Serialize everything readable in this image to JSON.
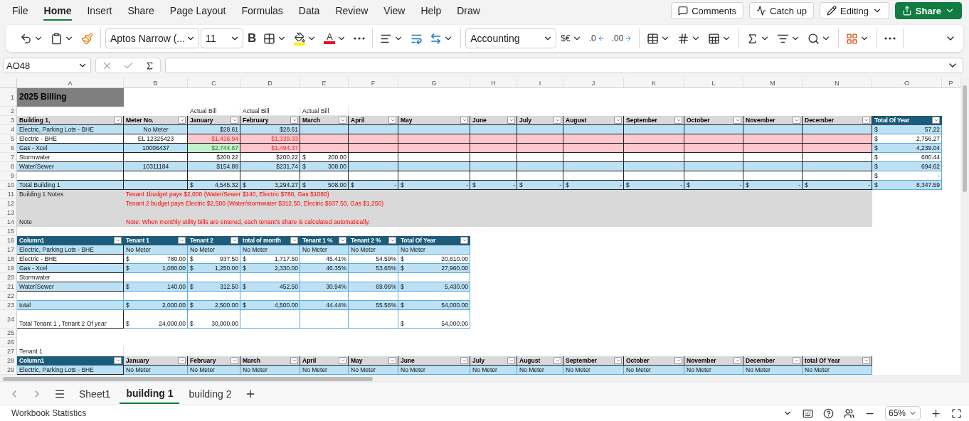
{
  "menu_tabs": [
    {
      "label": "File",
      "selected": false
    },
    {
      "label": "Home",
      "selected": true
    },
    {
      "label": "Insert",
      "selected": false
    },
    {
      "label": "Share",
      "selected": false
    },
    {
      "label": "Page Layout",
      "selected": false
    },
    {
      "label": "Formulas",
      "selected": false
    },
    {
      "label": "Data",
      "selected": false
    },
    {
      "label": "Review",
      "selected": false
    },
    {
      "label": "View",
      "selected": false
    },
    {
      "label": "Help",
      "selected": false
    },
    {
      "label": "Draw",
      "selected": false
    }
  ],
  "header_buttons": [
    {
      "kind": "comments",
      "label": "Comments"
    },
    {
      "kind": "catchup",
      "label": "Catch up"
    },
    {
      "kind": "editing",
      "label": "Editing",
      "caret": true
    },
    {
      "kind": "share",
      "label": "Share",
      "caret": true
    }
  ],
  "ribbon": {
    "groups": [
      [
        {
          "kind": "undo",
          "caret": true
        },
        {
          "kind": "paste",
          "caret": true
        },
        {
          "kind": "painter"
        }
      ],
      [
        {
          "kind": "font",
          "value": "Aptos Narrow (..."
        },
        {
          "kind": "size",
          "value": "11"
        },
        {
          "kind": "bold",
          "label": "B"
        },
        {
          "kind": "borders",
          "caret": true
        },
        {
          "kind": "fill",
          "caret": true
        },
        {
          "kind": "fontcolor",
          "label": "A",
          "caret": true
        },
        {
          "kind": "more"
        }
      ],
      [
        {
          "kind": "align",
          "caret": true
        },
        {
          "kind": "wrap"
        },
        {
          "kind": "merge",
          "caret": true
        }
      ],
      [
        {
          "kind": "format",
          "value": "Accounting"
        },
        {
          "kind": "currency",
          "label": "$€",
          "caret": true
        },
        {
          "kind": "decdec",
          "label": ".0"
        },
        {
          "kind": "incdec",
          "label": ".00"
        }
      ],
      [
        {
          "kind": "condfmt",
          "caret": true
        },
        {
          "kind": "cellstyles",
          "caret": true
        },
        {
          "kind": "formattable",
          "caret": true
        }
      ],
      [
        {
          "kind": "sum",
          "caret": true
        },
        {
          "kind": "sortfilter",
          "caret": true
        },
        {
          "kind": "find",
          "caret": true
        }
      ],
      [
        {
          "kind": "addins",
          "caret": true
        }
      ],
      [
        {
          "kind": "more"
        }
      ]
    ]
  },
  "formula_bar": {
    "name_box": "AO48"
  },
  "sheet": {
    "column_letters": [
      "A",
      "B",
      "C",
      "D",
      "E",
      "F",
      "G",
      "H",
      "I",
      "J",
      "K",
      "L",
      "M",
      "N",
      "O",
      "P"
    ],
    "rows": [
      {
        "number": "1",
        "tall": true,
        "cells": [
          {
            "text": "2025 Billing",
            "kind": "title"
          }
        ]
      },
      {
        "number": "2",
        "cells": [
          {},
          {},
          {
            "text": "Actual Bill"
          },
          {
            "text": "Actual Bill"
          },
          {
            "text": "Actual Bill"
          }
        ]
      },
      {
        "number": "3",
        "cells": [
          {
            "text": "Building 1,",
            "kind": "head",
            "filter": true
          },
          {
            "text": "Meter No.",
            "kind": "head",
            "filter": true
          },
          {
            "text": "January",
            "kind": "head",
            "filter": true
          },
          {
            "text": "February",
            "kind": "head",
            "filter": true
          },
          {
            "text": "March",
            "kind": "head",
            "filter": true
          },
          {
            "text": "April",
            "kind": "head",
            "filter": true
          },
          {
            "text": "May",
            "kind": "head",
            "filter": true
          },
          {
            "text": "June",
            "kind": "head",
            "filter": true
          },
          {
            "text": "July",
            "kind": "head",
            "filter": true
          },
          {
            "text": "August",
            "kind": "head",
            "filter": true
          },
          {
            "text": "September",
            "kind": "head",
            "filter": true
          },
          {
            "text": "October",
            "kind": "head",
            "filter": true
          },
          {
            "text": "November",
            "kind": "head",
            "filter": true
          },
          {
            "text": "December",
            "kind": "head",
            "filter": true
          },
          {
            "text": "Total Of Year",
            "kind": "navy",
            "filter": true
          }
        ]
      },
      {
        "number": "4",
        "cells": [
          {
            "text": "Electric, Parking Lots - BHE",
            "kind": "blue"
          },
          {
            "text": "No Meter",
            "kind": "blue",
            "centered": true
          },
          {
            "text": "$28.61",
            "kind": "blue",
            "numeric": true
          },
          {
            "text": "$28.61",
            "kind": "blue",
            "numeric": true
          },
          {
            "kind": "blue"
          },
          {
            "kind": "blue"
          },
          {
            "kind": "blue"
          },
          {
            "kind": "blue"
          },
          {
            "kind": "blue"
          },
          {
            "kind": "blue"
          },
          {
            "kind": "blue"
          },
          {
            "kind": "blue"
          },
          {
            "kind": "blue"
          },
          {
            "kind": "blue"
          },
          {
            "currency": "$",
            "text": "57.22",
            "kind": "band"
          }
        ]
      },
      {
        "number": "5",
        "cells": [
          {
            "text": "Electric - BHE",
            "kind": "white"
          },
          {
            "text": "EL 12325423",
            "kind": "white",
            "centered": true
          },
          {
            "text": "$1,416.94",
            "kind": "pink",
            "numeric": true
          },
          {
            "text": "$1,339.33",
            "kind": "pink",
            "numeric": true
          },
          {
            "kind": "pink"
          },
          {
            "kind": "pink"
          },
          {
            "kind": "pink"
          },
          {
            "kind": "pink"
          },
          {
            "kind": "pink"
          },
          {
            "kind": "pink"
          },
          {
            "kind": "pink"
          },
          {
            "kind": "pink"
          },
          {
            "kind": "pink"
          },
          {
            "kind": "pink"
          },
          {
            "currency": "$",
            "text": "2,756.27",
            "kind": "lined"
          }
        ]
      },
      {
        "number": "6",
        "cells": [
          {
            "text": "Gas - Xcel",
            "kind": "blue"
          },
          {
            "text": "10006437",
            "kind": "blue",
            "centered": true
          },
          {
            "text": "$2,744.67",
            "kind": "green",
            "numeric": true
          },
          {
            "text": "$1,494.37",
            "kind": "pink",
            "numeric": true
          },
          {
            "kind": "pink"
          },
          {
            "kind": "pink"
          },
          {
            "kind": "pink"
          },
          {
            "kind": "pink"
          },
          {
            "kind": "pink"
          },
          {
            "kind": "pink"
          },
          {
            "kind": "pink"
          },
          {
            "kind": "pink"
          },
          {
            "kind": "pink"
          },
          {
            "kind": "pink"
          },
          {
            "currency": "$",
            "text": "4,239.04",
            "kind": "band"
          }
        ]
      },
      {
        "number": "7",
        "cells": [
          {
            "text": "Stormwater",
            "kind": "white"
          },
          {
            "kind": "white"
          },
          {
            "text": "$200.22",
            "kind": "white",
            "numeric": true
          },
          {
            "text": "$200.22",
            "kind": "white",
            "numeric": true
          },
          {
            "currency": "$",
            "text": "200.00",
            "kind": "white"
          },
          {
            "kind": "white"
          },
          {
            "kind": "white"
          },
          {
            "kind": "white"
          },
          {
            "kind": "white"
          },
          {
            "kind": "white"
          },
          {
            "kind": "white"
          },
          {
            "kind": "white"
          },
          {
            "kind": "white"
          },
          {
            "kind": "white"
          },
          {
            "currency": "$",
            "text": "600.44",
            "kind": "lined"
          }
        ]
      },
      {
        "number": "8",
        "cells": [
          {
            "text": "Water/Sewer",
            "kind": "blue"
          },
          {
            "text": "10311184",
            "kind": "blue",
            "centered": true
          },
          {
            "text": "$154.88",
            "kind": "blue",
            "numeric": true
          },
          {
            "text": "$231.74",
            "kind": "blue",
            "numeric": true
          },
          {
            "currency": "$",
            "text": "308.00",
            "kind": "blue"
          },
          {
            "kind": "blue"
          },
          {
            "kind": "blue"
          },
          {
            "kind": "blue"
          },
          {
            "kind": "blue"
          },
          {
            "kind": "blue"
          },
          {
            "kind": "blue"
          },
          {
            "kind": "blue"
          },
          {
            "kind": "blue"
          },
          {
            "kind": "blue"
          },
          {
            "currency": "$",
            "text": "694.62",
            "kind": "band"
          }
        ]
      },
      {
        "number": "9",
        "cells": [
          {
            "kind": "white"
          },
          {
            "kind": "white"
          },
          {
            "kind": "white"
          },
          {
            "kind": "white"
          },
          {
            "kind": "white"
          },
          {
            "kind": "white"
          },
          {
            "kind": "white"
          },
          {
            "kind": "white"
          },
          {
            "kind": "white"
          },
          {
            "kind": "white"
          },
          {
            "kind": "white"
          },
          {
            "kind": "white"
          },
          {
            "kind": "white"
          },
          {
            "kind": "white"
          },
          {
            "currency": "$",
            "text": "-",
            "kind": "lined"
          }
        ]
      },
      {
        "number": "10",
        "cells": [
          {
            "text": "Total Building 1",
            "kind": "blue"
          },
          {
            "kind": "blue"
          },
          {
            "currency": "$",
            "text": "4,545.32",
            "kind": "blue"
          },
          {
            "currency": "$",
            "text": "3,294.27",
            "kind": "blue"
          },
          {
            "currency": "$",
            "text": "508.00",
            "kind": "blue"
          },
          {
            "currency": "$",
            "text": "-",
            "kind": "blue"
          },
          {
            "currency": "$",
            "text": "-",
            "kind": "blue"
          },
          {
            "currency": "$",
            "text": "-",
            "kind": "blue"
          },
          {
            "currency": "$",
            "text": "-",
            "kind": "blue"
          },
          {
            "currency": "$",
            "text": "-",
            "kind": "blue"
          },
          {
            "currency": "$",
            "text": "-",
            "kind": "blue"
          },
          {
            "currency": "$",
            "text": "-",
            "kind": "blue"
          },
          {
            "currency": "$",
            "text": "-",
            "kind": "blue"
          },
          {
            "currency": "$",
            "text": "-",
            "kind": "blue"
          },
          {
            "currency": "$",
            "text": "8,347.59",
            "kind": "band"
          }
        ]
      },
      {
        "number": "11",
        "cells": [
          {
            "text": "Building 1 Notes",
            "kind": "gray"
          },
          {
            "text": "Tenant 1budget pays $2,000 (Water/Sewer $140, Electric $780, Gas $1080)",
            "kind": "note"
          }
        ]
      },
      {
        "number": "12",
        "cells": [
          {
            "kind": "gray"
          },
          {
            "text": "Tenant 2 budget pays Electric $2,500 (Water/stormwater $312.50, Electric $937.50, Gas $1,250)",
            "kind": "note"
          }
        ]
      },
      {
        "number": "13",
        "cells": [
          {
            "kind": "gray"
          },
          {
            "kind": "gray"
          }
        ]
      },
      {
        "number": "14",
        "cells": [
          {
            "text": "Note",
            "kind": "gray"
          },
          {
            "text": "Note: When monthly utility bills are entered, each tenant's share is calculated automatically.",
            "kind": "note"
          }
        ]
      },
      {
        "number": "15",
        "cells": []
      },
      {
        "number": "16",
        "cells": [
          {
            "text": "Column1",
            "kind": "navy",
            "filter": true
          },
          {
            "text": "Tenant 1",
            "kind": "navy",
            "filter": true
          },
          {
            "text": "Tenant 2",
            "kind": "navy",
            "filter": true
          },
          {
            "text": "total of month",
            "kind": "navy",
            "filter": true
          },
          {
            "text": "Tenant 1 %",
            "kind": "navy",
            "filter": true
          },
          {
            "text": "Tenant 2 %",
            "kind": "navy",
            "filter": true
          },
          {
            "text": "Total Of Year",
            "kind": "navy",
            "filter": true
          }
        ]
      },
      {
        "number": "17",
        "cells": [
          {
            "text": "Electric, Parking Lots - BHE",
            "kind": "blue"
          },
          {
            "text": "No Meter",
            "kind": "band"
          },
          {
            "text": "No Meter",
            "kind": "band"
          },
          {
            "text": "No Meter",
            "kind": "band"
          },
          {
            "text": "No Meter",
            "kind": "band"
          },
          {
            "text": "No Meter",
            "kind": "band"
          },
          {
            "text": "No Meter",
            "kind": "band"
          }
        ]
      },
      {
        "number": "18",
        "cells": [
          {
            "text": "Electric - BHE",
            "kind": "white"
          },
          {
            "currency": "$",
            "text": "780.00",
            "kind": "lined"
          },
          {
            "currency": "$",
            "text": "937.50",
            "kind": "lined"
          },
          {
            "currency": "$",
            "text": "1,717.50",
            "kind": "lined"
          },
          {
            "text": "45.41%",
            "kind": "lined",
            "numeric": true
          },
          {
            "text": "54.59%",
            "kind": "lined",
            "numeric": true
          },
          {
            "currency": "$",
            "text": "20,610.00",
            "kind": "lined"
          }
        ]
      },
      {
        "number": "19",
        "cells": [
          {
            "text": "Gas - Xcel",
            "kind": "blue"
          },
          {
            "currency": "$",
            "text": "1,080.00",
            "kind": "band"
          },
          {
            "currency": "$",
            "text": "1,250.00",
            "kind": "band"
          },
          {
            "currency": "$",
            "text": "2,330.00",
            "kind": "band"
          },
          {
            "text": "46.35%",
            "kind": "band",
            "numeric": true
          },
          {
            "text": "53.65%",
            "kind": "band",
            "numeric": true
          },
          {
            "currency": "$",
            "text": "27,960.00",
            "kind": "band"
          }
        ]
      },
      {
        "number": "20",
        "cells": [
          {
            "text": "Stormwater",
            "kind": "white"
          },
          {
            "kind": "lined"
          },
          {
            "kind": "lined"
          },
          {
            "kind": "lined"
          },
          {
            "kind": "lined"
          },
          {
            "kind": "lined"
          },
          {
            "kind": "lined"
          }
        ]
      },
      {
        "number": "21",
        "cells": [
          {
            "text": "Water/Sewer",
            "kind": "blue"
          },
          {
            "currency": "$",
            "text": "140.00",
            "kind": "band"
          },
          {
            "currency": "$",
            "text": "312.50",
            "kind": "band"
          },
          {
            "currency": "$",
            "text": "452.50",
            "kind": "band"
          },
          {
            "text": "30.94%",
            "kind": "band",
            "numeric": true
          },
          {
            "text": "69.06%",
            "kind": "band",
            "numeric": true
          },
          {
            "currency": "$",
            "text": "5,430.00",
            "kind": "band"
          }
        ]
      },
      {
        "number": "22",
        "cells": [
          {
            "kind": "lined"
          },
          {
            "kind": "lined"
          },
          {
            "kind": "lined"
          },
          {
            "kind": "lined"
          },
          {
            "kind": "lined"
          },
          {
            "kind": "lined"
          },
          {
            "kind": "lined"
          }
        ]
      },
      {
        "number": "23",
        "cells": [
          {
            "text": "total",
            "kind": "band"
          },
          {
            "currency": "$",
            "text": "2,000.00",
            "kind": "band"
          },
          {
            "currency": "$",
            "text": "2,500.00",
            "kind": "band"
          },
          {
            "currency": "$",
            "text": "4,500.00",
            "kind": "band"
          },
          {
            "text": "44.44%",
            "kind": "band",
            "numeric": true
          },
          {
            "text": "55.56%",
            "kind": "band",
            "numeric": true
          },
          {
            "currency": "$",
            "text": "54,000.00",
            "kind": "band"
          }
        ]
      },
      {
        "number": "24",
        "tall": true,
        "cells": [
          {
            "text": "Total Tenant 1 , Tenant 2 Of year",
            "kind": "white"
          },
          {
            "currency": "$",
            "text": "24,000.00",
            "kind": "lined"
          },
          {
            "currency": "$",
            "text": "30,000.00",
            "kind": "lined"
          },
          {
            "kind": "lined"
          },
          {
            "kind": "lined"
          },
          {
            "kind": "lined"
          },
          {
            "currency": "$",
            "text": "54,000.00",
            "kind": "lined"
          }
        ]
      },
      {
        "number": "25",
        "cells": []
      },
      {
        "number": "26",
        "cells": []
      },
      {
        "number": "27",
        "cells": [
          {
            "text": "Tenant 1"
          }
        ]
      },
      {
        "number": "28",
        "cells": [
          {
            "text": "Column1",
            "kind": "navy",
            "filter": true
          },
          {
            "text": "January",
            "kind": "head",
            "filter": true
          },
          {
            "text": "February",
            "kind": "head",
            "filter": true
          },
          {
            "text": "March",
            "kind": "head",
            "filter": true
          },
          {
            "text": "April",
            "kind": "head",
            "filter": true
          },
          {
            "text": "May",
            "kind": "head",
            "filter": true
          },
          {
            "text": "June",
            "kind": "head",
            "filter": true
          },
          {
            "text": "July",
            "kind": "head",
            "filter": true
          },
          {
            "text": "August",
            "kind": "head",
            "filter": true
          },
          {
            "text": "September",
            "kind": "head",
            "filter": true
          },
          {
            "text": "October",
            "kind": "head",
            "filter": true
          },
          {
            "text": "November",
            "kind": "head",
            "filter": true
          },
          {
            "text": "December",
            "kind": "head",
            "filter": true
          },
          {
            "text": "total Of Year",
            "kind": "head",
            "filter": true
          }
        ]
      },
      {
        "number": "29",
        "cells": [
          {
            "text": "Electric, Parking Lots - BHE",
            "kind": "blue"
          },
          {
            "text": "No Meter",
            "kind": "band"
          },
          {
            "text": "No Meter",
            "kind": "band"
          },
          {
            "text": "No Meter",
            "kind": "band"
          },
          {
            "text": "No Meter",
            "kind": "band"
          },
          {
            "text": "No Meter",
            "kind": "band"
          },
          {
            "text": "No Meter",
            "kind": "band"
          },
          {
            "text": "No Meter",
            "kind": "band"
          },
          {
            "text": "No Meter",
            "kind": "band"
          },
          {
            "text": "No Meter",
            "kind": "band"
          },
          {
            "text": "No Meter",
            "kind": "band"
          },
          {
            "text": "No Meter",
            "kind": "band"
          },
          {
            "text": "No Meter",
            "kind": "band"
          },
          {
            "text": "No Meter",
            "kind": "band"
          }
        ]
      }
    ]
  },
  "sheet_tabs": [
    {
      "label": "Sheet1",
      "selected": false
    },
    {
      "label": "building 1",
      "selected": true
    },
    {
      "label": "building 2",
      "selected": false
    }
  ],
  "status_bar": {
    "label": "Workbook Statistics",
    "zoom": "65%"
  }
}
